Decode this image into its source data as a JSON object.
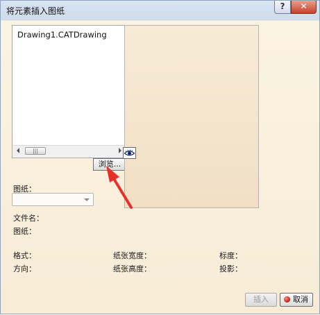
{
  "window": {
    "title": "将元素插入图纸",
    "help_label": "?",
    "close_label": "✕"
  },
  "list": {
    "items": [
      "Drawing1.CATDrawing"
    ],
    "scroll_thumb_label": "|||"
  },
  "browse_button": "浏览...",
  "sheet_select": {
    "label": "图纸：",
    "value": ""
  },
  "info": {
    "filename_label": "文件名：",
    "sheet_label": "图纸：",
    "format_label": "格式：",
    "orientation_label": "方向：",
    "paper_width_label": "纸张宽度：",
    "paper_height_label": "纸张高度：",
    "scale_label": "标度：",
    "projection_label": "投影："
  },
  "buttons": {
    "insert": "插入",
    "cancel": "取消"
  },
  "icons": {
    "preview_toggle": "eye-icon",
    "cancel": "red-circle-icon",
    "annotation": "red-arrow-icon"
  },
  "colors": {
    "annotation_arrow": "#e8302a",
    "cancel_dot": "#c0180a",
    "close_button": "#c74129"
  }
}
